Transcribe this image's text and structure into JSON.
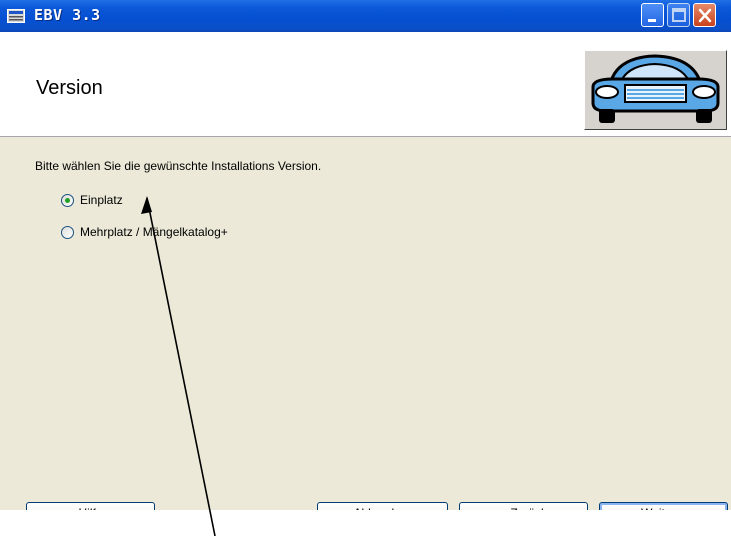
{
  "window": {
    "title": "EBV 3.3",
    "icon": "app-window-icon",
    "controls": {
      "minimize": "minimize-icon",
      "maximize": "maximize-icon",
      "close": "close-icon"
    }
  },
  "header": {
    "title": "Version",
    "logo": "car-logo"
  },
  "content": {
    "instruction": "Bitte wählen Sie die gewünschte Installations Version.",
    "options": [
      {
        "label": "Einplatz",
        "selected": true
      },
      {
        "label": "Mehrplatz / Mängelkatalog+",
        "selected": false
      }
    ]
  },
  "buttons": {
    "help": "Hilfe",
    "cancel": "Abbrechen",
    "back": "< Zurück",
    "next": "Weiter >"
  },
  "colors": {
    "titlebar": "#0550d2",
    "dialog_bg": "#ece9d8",
    "radio_selected": "#21a121",
    "car_blue": "#5aa7e6"
  },
  "annotation": {
    "type": "arrow",
    "target": "Einplatz"
  }
}
